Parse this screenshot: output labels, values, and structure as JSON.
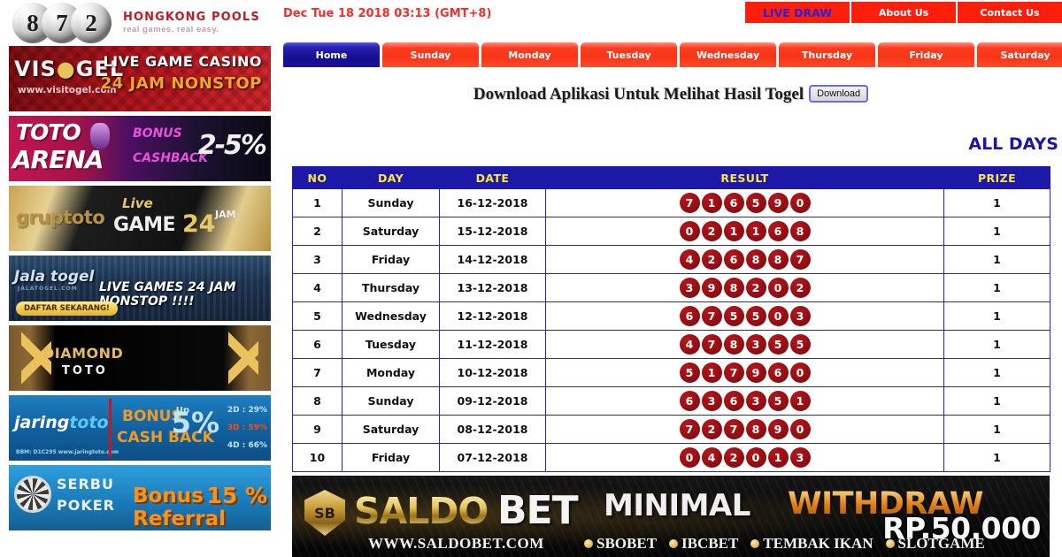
{
  "logo": {
    "balls": [
      "8",
      "7",
      "2"
    ],
    "brand_name": "HONGKONG POOLS",
    "brand_tagline": "real games. real easy."
  },
  "topbar": {
    "clock": "Dec Tue 18 2018 03:13 (GMT+8)",
    "buttons": [
      {
        "label": "LIVE DRAW",
        "style": "live"
      },
      {
        "label": "About Us",
        "style": "normal"
      },
      {
        "label": "Contact Us",
        "style": "normal"
      }
    ]
  },
  "tabs": [
    {
      "label": "Home",
      "active": true
    },
    {
      "label": "Sunday",
      "active": false
    },
    {
      "label": "Monday",
      "active": false
    },
    {
      "label": "Tuesday",
      "active": false
    },
    {
      "label": "Wednesday",
      "active": false
    },
    {
      "label": "Thursday",
      "active": false
    },
    {
      "label": "Friday",
      "active": false
    },
    {
      "label": "Saturday",
      "active": false
    }
  ],
  "download": {
    "title": "Download Aplikasi Untuk Melihat Hasil Togel",
    "button_label": "Download"
  },
  "section": {
    "all_days_label": "ALL DAYS"
  },
  "colors": {
    "header_blue": "#1c18a8",
    "header_yellow": "#ffe63a",
    "tab_red": "#fd3d22",
    "ball_red": "#9d0f13",
    "clock_red": "#fd2a2a",
    "alldays_blue": "#1d14a8"
  },
  "table": {
    "columns": [
      "NO",
      "DAY",
      "DATE",
      "RESULT",
      "PRIZE"
    ],
    "rows": [
      {
        "no": "1",
        "day": "Sunday",
        "date": "16-12-2018",
        "result": [
          "7",
          "1",
          "6",
          "5",
          "9",
          "0"
        ],
        "prize": "1"
      },
      {
        "no": "2",
        "day": "Saturday",
        "date": "15-12-2018",
        "result": [
          "0",
          "2",
          "1",
          "1",
          "6",
          "8"
        ],
        "prize": "1"
      },
      {
        "no": "3",
        "day": "Friday",
        "date": "14-12-2018",
        "result": [
          "4",
          "2",
          "6",
          "8",
          "8",
          "7"
        ],
        "prize": "1"
      },
      {
        "no": "4",
        "day": "Thursday",
        "date": "13-12-2018",
        "result": [
          "3",
          "9",
          "8",
          "2",
          "0",
          "2"
        ],
        "prize": "1"
      },
      {
        "no": "5",
        "day": "Wednesday",
        "date": "12-12-2018",
        "result": [
          "6",
          "7",
          "5",
          "5",
          "0",
          "3"
        ],
        "prize": "1"
      },
      {
        "no": "6",
        "day": "Tuesday",
        "date": "11-12-2018",
        "result": [
          "4",
          "7",
          "8",
          "3",
          "5",
          "5"
        ],
        "prize": "1"
      },
      {
        "no": "7",
        "day": "Monday",
        "date": "10-12-2018",
        "result": [
          "5",
          "1",
          "7",
          "9",
          "6",
          "0"
        ],
        "prize": "1"
      },
      {
        "no": "8",
        "day": "Sunday",
        "date": "09-12-2018",
        "result": [
          "6",
          "3",
          "6",
          "3",
          "5",
          "1"
        ],
        "prize": "1"
      },
      {
        "no": "9",
        "day": "Saturday",
        "date": "08-12-2018",
        "result": [
          "7",
          "2",
          "7",
          "8",
          "9",
          "0"
        ],
        "prize": "1"
      },
      {
        "no": "10",
        "day": "Friday",
        "date": "07-12-2018",
        "result": [
          "0",
          "4",
          "2",
          "0",
          "1",
          "3"
        ],
        "prize": "1"
      }
    ]
  },
  "sidebar_banners": [
    {
      "id": "visitogel",
      "brand": "VIS TOGEL",
      "brand_pre": "VIS",
      "brand_post": "GEL",
      "url": "www.visitogel.com",
      "line1": "LIVE GAME CASINO",
      "line2": "24 JAM NONSTOP"
    },
    {
      "id": "totoarena",
      "line1": "TOTO",
      "line2": "ARENA",
      "line3": "BONUS",
      "line4": "CASHBACK",
      "line5": "2-5%"
    },
    {
      "id": "gruptoto",
      "brand": "gruptoto",
      "line1": "Live",
      "line2": "GAME",
      "line3": "24",
      "line4": "JAM"
    },
    {
      "id": "jalatogel",
      "brand": "Jala togel",
      "sub": "JALATOGEL.COM",
      "line1": "LIVE GAMES 24 JAM NONSTOP !!!!",
      "cta": "DAFTAR SEKARANG!"
    },
    {
      "id": "diamondtoto",
      "line1": "DIAMOND",
      "line2": "TOTO"
    },
    {
      "id": "jaringtoto",
      "brand_pre": "jaring",
      "brand_post": "toto",
      "sub": "BBM: D1C295    www.jaringtoto.com",
      "line1": "BONUS",
      "line2": "CASH BACK",
      "up": "Up",
      "pct": "5%",
      "r1": "2D : 29%",
      "r2": "3D : 59%",
      "r3": "4D : 66%"
    },
    {
      "id": "serbupoker",
      "line1": "SERBU",
      "line2": "POKER",
      "line3": "Bonus Referral",
      "line4": "15 %"
    }
  ],
  "bottom_banner": {
    "shield": "SB",
    "brand_1": "SALDO",
    "brand_2": "BET",
    "minimal": "MINIMAL",
    "withdraw": "WITHDRAW",
    "amount": "RP.50.000",
    "url": "WWW.SALDOBET.COM",
    "features": [
      "SBOBET",
      "IBCBET",
      "TEMBAK IKAN",
      "SLOTGAME"
    ]
  }
}
